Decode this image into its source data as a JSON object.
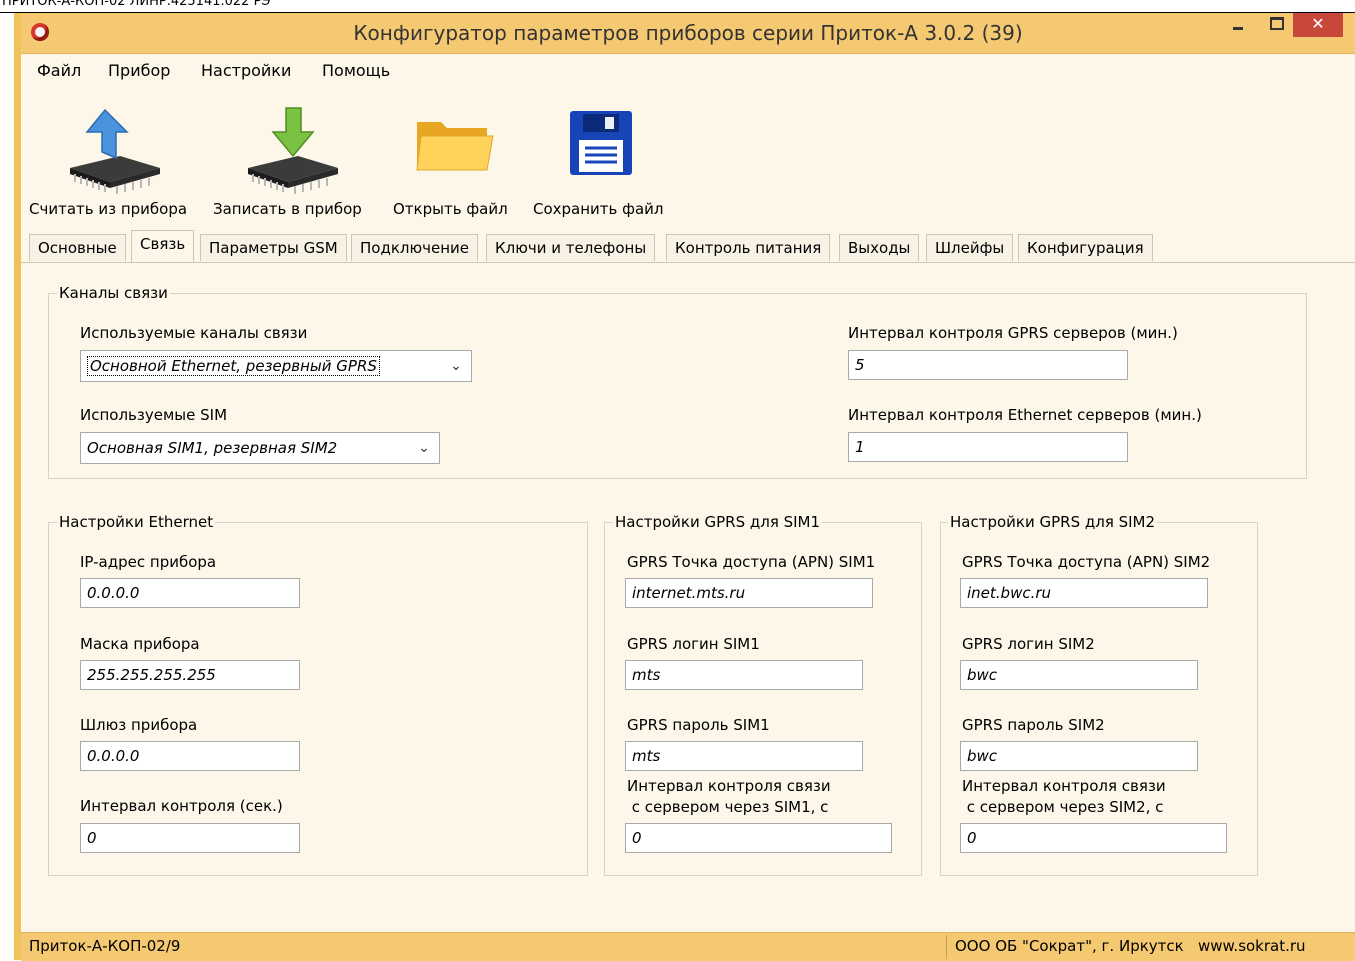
{
  "top_snippet": "ПРИТОК-А-КОП-02 ЛИНР.425141.022 РЭ",
  "window": {
    "title": "Конфигуратор параметров приборов серии Приток-А   3.0.2 (39)",
    "close_symbol": "✕"
  },
  "menu": [
    "Файл",
    "Прибор",
    "Настройки",
    "Помощь"
  ],
  "toolbar": {
    "read": "Считать из прибора",
    "write": "Записать в прибор",
    "open": "Открыть файл",
    "save": "Сохранить файл"
  },
  "tabs": [
    "Основные",
    "Связь",
    "Параметры GSM",
    "Подключение",
    "Ключи и телефоны",
    "Контроль питания",
    "Выходы",
    "Шлейфы",
    "Конфигурация"
  ],
  "active_tab": "Связь",
  "channels": {
    "group_title": "Каналы связи",
    "channels_label": "Используемые каналы связи",
    "channels_value": "Основной Ethernet, резервный GPRS",
    "sim_label": "Используемые SIM",
    "sim_value": "Основная SIM1, резервная SIM2",
    "gprs_interval_label": "Интервал контроля GPRS серверов (мин.)",
    "gprs_interval_value": "5",
    "eth_interval_label": "Интервал контроля Ethernet серверов (мин.)",
    "eth_interval_value": "1"
  },
  "ethernet": {
    "group_title": "Настройки Ethernet",
    "ip_label": "IP-адрес прибора",
    "ip_value": "0.0.0.0",
    "mask_label": "Маска прибора",
    "mask_value": "255.255.255.255",
    "gateway_label": "Шлюз прибора",
    "gateway_value": "0.0.0.0",
    "interval_label": "Интервал контроля (сек.)",
    "interval_value": "0"
  },
  "sim1": {
    "group_title": "Настройки GPRS для SIM1",
    "apn_label": "GPRS Точка доступа (APN) SIM1",
    "apn_value": "internet.mts.ru",
    "login_label": "GPRS логин SIM1",
    "login_value": "mts",
    "password_label": "GPRS пароль SIM1",
    "password_value": "mts",
    "interval_label_1": "Интервал контроля связи",
    "interval_label_2": " с сервером через SIM1, с",
    "interval_value": "0"
  },
  "sim2": {
    "group_title": "Настройки GPRS для SIM2",
    "apn_label": "GPRS Точка доступа (APN) SIM2",
    "apn_value": "inet.bwc.ru",
    "login_label": "GPRS логин SIM2",
    "login_value": "bwc",
    "password_label": "GPRS пароль SIM2",
    "password_value": "bwc",
    "interval_label_1": "Интервал контроля связи",
    "interval_label_2": " с сервером через SIM2, с",
    "interval_value": "0"
  },
  "status": {
    "device": "Приток-А-КОП-02/9",
    "company": "ООО ОБ \"Сократ\", г. Иркутск   www.sokrat.ru"
  }
}
